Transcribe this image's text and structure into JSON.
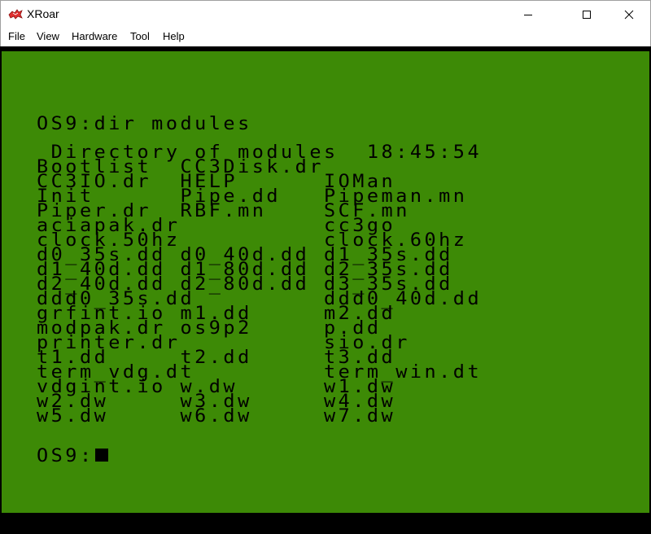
{
  "window": {
    "title": "XRoar",
    "app_icon": "xroar-dragon-icon",
    "controls": {
      "minimize": "minimize-icon",
      "maximize": "maximize-icon",
      "close": "close-icon"
    }
  },
  "menu": {
    "items": [
      "File",
      "View",
      "Hardware",
      "Tool",
      "Help"
    ]
  },
  "terminal": {
    "background_color": "#3d8a06",
    "text_color": "#000000",
    "command_line": "OS9:dir modules",
    "directory_header": " Directory of modules  18:45:54",
    "listing": [
      "Bootlist  CC3Disk.dr",
      "CC3IO.dr  HELP      IOMan",
      "Init      Pipe.dd   Pipeman.mn",
      "Piper.dr  RBF.mn    SCF.mn",
      "aciapak.dr          cc3go",
      "clock.50hz          clock.60hz",
      "d0_35s.dd d0_40d.dd d1_35s.dd",
      "d1_40d.dd d1_80d.dd d2_35s.dd",
      "d2_40d.dd d2_80d.dd d3_35s.dd",
      "ddd0_35s.dd         ddd0_40d.dd",
      "grfint.io m1.dd     m2.dd",
      "modpak.dr os9p2     p.dd",
      "printer.dr          sio.dr",
      "t1.dd     t2.dd     t3.dd",
      "term_vdg.dt         term_win.dt",
      "vdgint.io w.dw      w1.dw",
      "w2.dw     w3.dw     w4.dw",
      "w5.dw     w6.dw     w7.dw"
    ],
    "prompt": "OS9:"
  }
}
